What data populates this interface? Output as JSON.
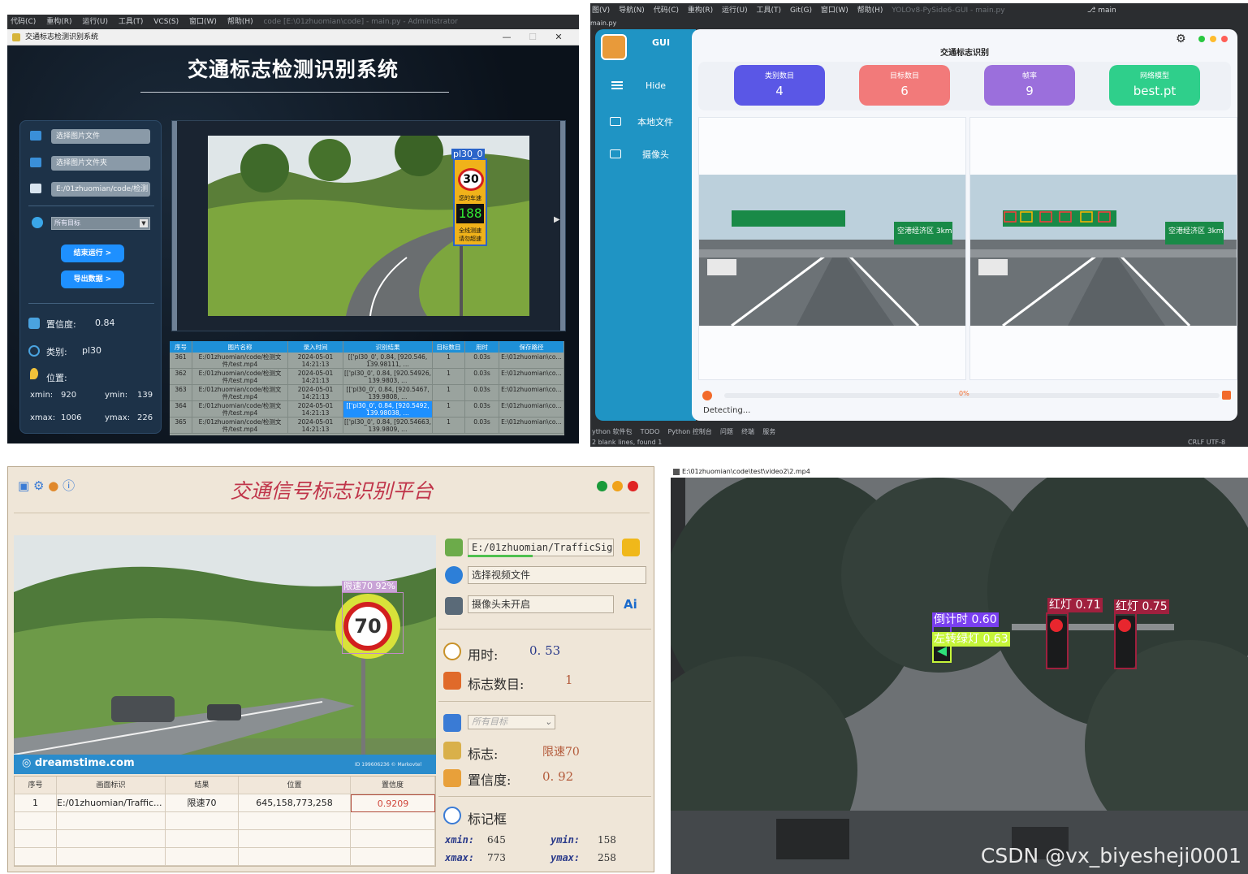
{
  "q1": {
    "ide_menu": [
      "代码(C)",
      "重构(R)",
      "运行(U)",
      "工具(T)",
      "VCS(S)",
      "窗口(W)",
      "帮助(H)"
    ],
    "ide_path": "code [E:\\01zhuomian\\code] - main.py - Administrator",
    "window_title": "交通标志检测识别系统",
    "app_title": "交通标志检测识别系统",
    "buttons": {
      "select_image": "选择图片文件",
      "select_folder": "选择图片文件夹",
      "path_value": "E:/01zhuomian/code/检测",
      "target_select": "所有目标",
      "stop": "结束运行 >",
      "export": "导出数据 >"
    },
    "info": {
      "confidence_label": "置信度:",
      "confidence_value": "0.84",
      "class_label": "类别:",
      "class_value": "pl30",
      "position_label": "位置:",
      "xmin_label": "xmin:",
      "xmin_value": "920",
      "ymin_label": "ymin:",
      "ymin_value": "139",
      "xmax_label": "xmax:",
      "xmax_value": "1006",
      "ymax_label": "ymax:",
      "ymax_value": "226"
    },
    "detection_label": "pl30_0",
    "sign": {
      "speed": "30",
      "line1": "您的车速",
      "digits": "188",
      "line2": "全线测速",
      "line3": "请勿超速"
    },
    "table": {
      "headers": [
        "序号",
        "图片名称",
        "录入时间",
        "识别结果",
        "目标数目",
        "用时",
        "保存路径"
      ],
      "rows": [
        [
          "361",
          "E:/01zhuomian/code/检测文件/test.mp4",
          "2024-05-01 14:21:13",
          "[['pl30_0', 0.84, [920.546, 139.98111, …",
          "1",
          "0.03s",
          "E:\\01zhuomian\\co…"
        ],
        [
          "362",
          "E:/01zhuomian/code/检测文件/test.mp4",
          "2024-05-01 14:21:13",
          "[['pl30_0', 0.84, [920.54926, 139.9803, …",
          "1",
          "0.03s",
          "E:\\01zhuomian\\co…"
        ],
        [
          "363",
          "E:/01zhuomian/code/检测文件/test.mp4",
          "2024-05-01 14:21:13",
          "[['pl30_0', 0.84, [920.5467, 139.9808, …",
          "1",
          "0.03s",
          "E:\\01zhuomian\\co…"
        ],
        [
          "364",
          "E:/01zhuomian/code/检测文件/test.mp4",
          "2024-05-01 14:21:13",
          "[['pl30_0', 0.84, [920.5492, 139.98038, …",
          "1",
          "0.03s",
          "E:\\01zhuomian\\co…"
        ],
        [
          "365",
          "E:/01zhuomian/code/检测文件/test.mp4",
          "2024-05-01 14:21:13",
          "[['pl30_0', 0.84, [920.54663, 139.9809, …",
          "1",
          "0.03s",
          "E:\\01zhuomian\\co…"
        ]
      ]
    }
  },
  "q2": {
    "ide_menu": [
      "图(V)",
      "导航(N)",
      "代码(C)",
      "重构(R)",
      "运行(U)",
      "工具(T)",
      "Git(G)",
      "窗口(W)",
      "帮助(H)"
    ],
    "ide_project": "YOLOv8-PySide6-GUI - main.py",
    "branch": "main",
    "file_tab": "main.py",
    "sidebar": {
      "title": "GUI",
      "items": [
        "Hide",
        "本地文件",
        "摄像头"
      ]
    },
    "panel_title": "交通标志识别",
    "cards": [
      {
        "label": "类别数目",
        "value": "4",
        "color": "#5a57e6"
      },
      {
        "label": "目标数目",
        "value": "6",
        "color": "#f27a7a"
      },
      {
        "label": "帧率",
        "value": "9",
        "color": "#9b6fdc"
      },
      {
        "label": "网络模型",
        "value": "best.pt",
        "color": "#2fcf8b"
      }
    ],
    "road_sign_text": "空港经济区 3km",
    "progress_percent": 0,
    "progress_text": "0%",
    "status": "Detecting...",
    "bottom_items": [
      "ython 软件包",
      "TODO",
      "Python 控制台",
      "问题",
      "终端",
      "服务"
    ],
    "bottom_status": "2 blank lines, found 1",
    "encoding": "CRLF   UTF-8"
  },
  "q3": {
    "title": "交通信号标志识别平台",
    "detection_label": "限速70 92%",
    "sign_value": "70",
    "photo_credit": "dreamstime.com",
    "photo_id": "ID 199606236 © Markovtel",
    "file_path": "E:/01zhuomian/TrafficSignRe",
    "select_video": "选择视频文件",
    "camera_status": "摄像头未开启",
    "time_label": "用时:",
    "time_value": "0. 53",
    "count_label": "标志数目:",
    "count_value": "1",
    "target_select": "所有目标",
    "sign_label": "标志:",
    "sign_class": "限速70",
    "confidence_label": "置信度:",
    "confidence_value": "0. 92",
    "bbox_label": "标记框",
    "xmin_label": "xmin:",
    "xmin_value": "645",
    "ymin_label": "ymin:",
    "ymin_value": "158",
    "xmax_label": "xmax:",
    "xmax_value": "773",
    "ymax_label": "ymax:",
    "ymax_value": "258",
    "table": {
      "headers": [
        "序号",
        "画面标识",
        "结果",
        "位置",
        "置信度"
      ],
      "rows": [
        [
          "1",
          "E:/01zhuomian/Traffic...",
          "限速70",
          "645,158,773,258",
          "0.9209"
        ]
      ]
    }
  },
  "q4": {
    "window_title": "E:\\01zhuomian\\code\\test\\video2\\2.mp4",
    "detections": [
      {
        "label": "倒计时 0.60",
        "color": "#7a3ff0",
        "text_color": "#ffffff"
      },
      {
        "label": "左转绿灯 0.63",
        "color": "#c6f53a",
        "text_color": "#ffffff"
      },
      {
        "label": "红灯 0.71",
        "color": "#a0203e",
        "text_color": "#ffffff"
      },
      {
        "label": "红灯 0.75",
        "color": "#a0203e",
        "text_color": "#ffffff"
      }
    ],
    "watermark": "CSDN @vx_biyesheji0001"
  }
}
